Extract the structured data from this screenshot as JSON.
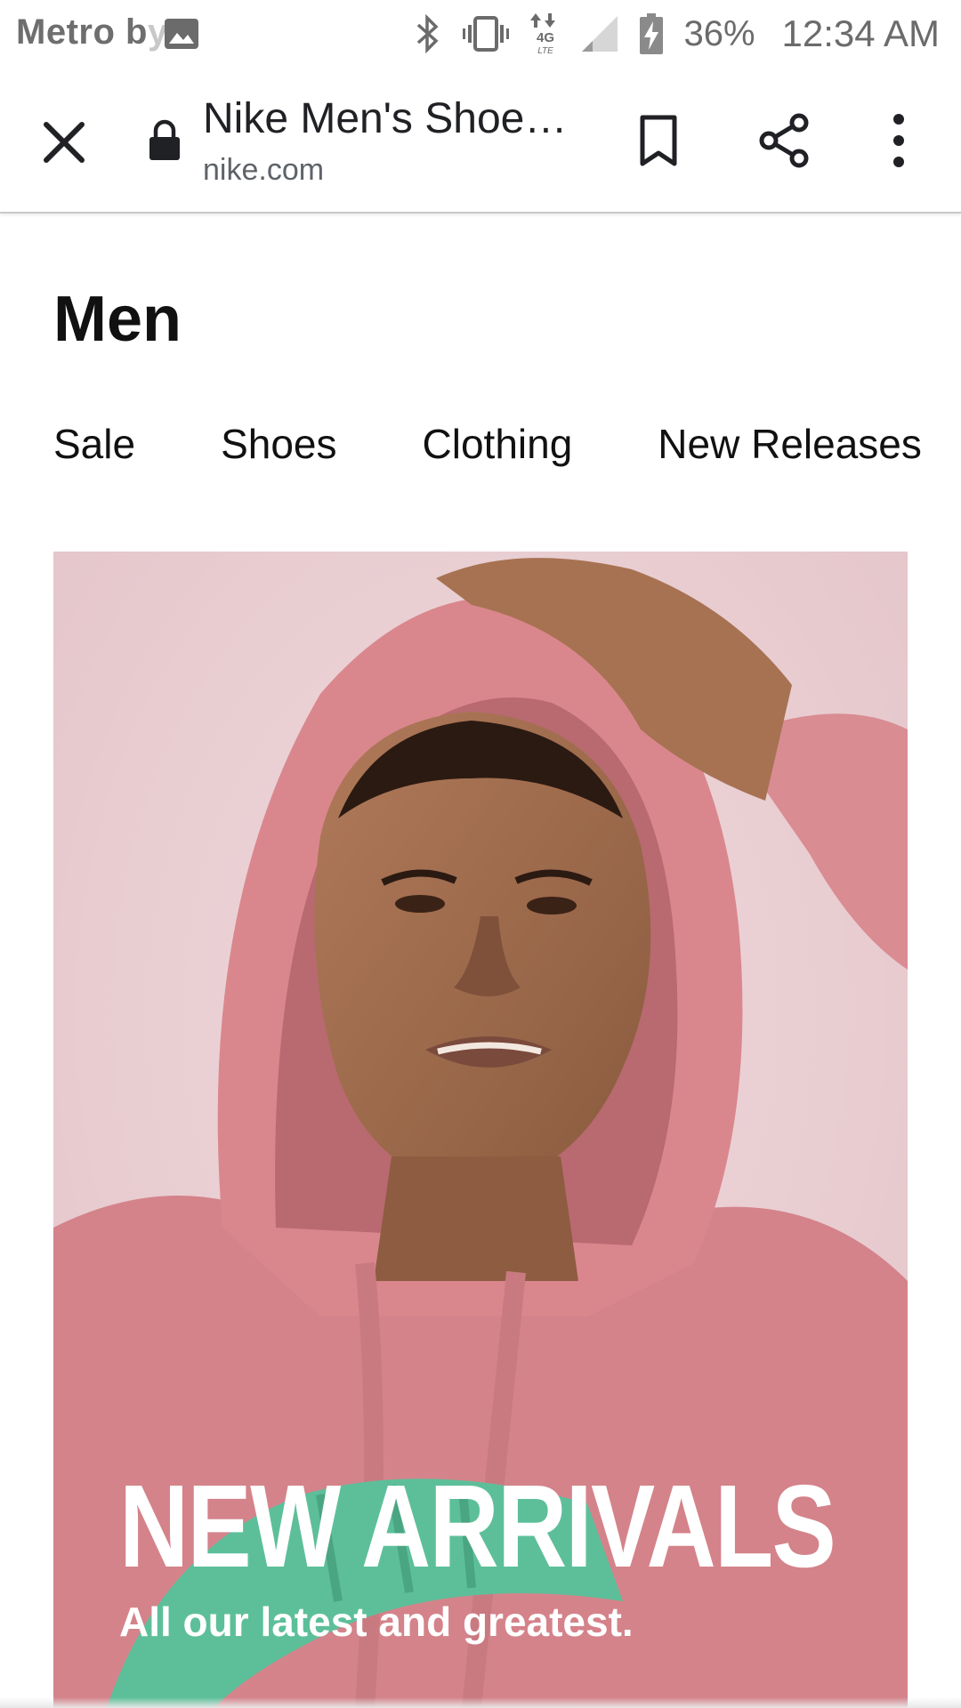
{
  "status_bar": {
    "carrier_main": "Metro b",
    "carrier_fade": "y",
    "battery_percent": "36%",
    "time": "12:34 AM",
    "icons": [
      "gallery-icon",
      "bluetooth-icon",
      "vibrate-icon",
      "network-4g-lte-icon",
      "signal-icon",
      "battery-charging-icon"
    ]
  },
  "toolbar": {
    "page_title": "Nike Men's Shoes, Clothing & Accessories",
    "url": "nike.com",
    "icons": [
      "close-icon",
      "lock-icon",
      "bookmark-icon",
      "share-icon",
      "more-vert-icon"
    ]
  },
  "page": {
    "title": "Men",
    "tabs": [
      {
        "label": "Sale"
      },
      {
        "label": "Shoes"
      },
      {
        "label": "Clothing"
      },
      {
        "label": "New Releases"
      }
    ],
    "hero": {
      "headline": "NEW ARRIVALS",
      "subline": "All our latest and greatest."
    }
  },
  "colors": {
    "hero_background": "#e9cfd3",
    "hoodie": "#d9858a",
    "logo_green": "#5dbf9a",
    "text_dark": "#111111"
  }
}
